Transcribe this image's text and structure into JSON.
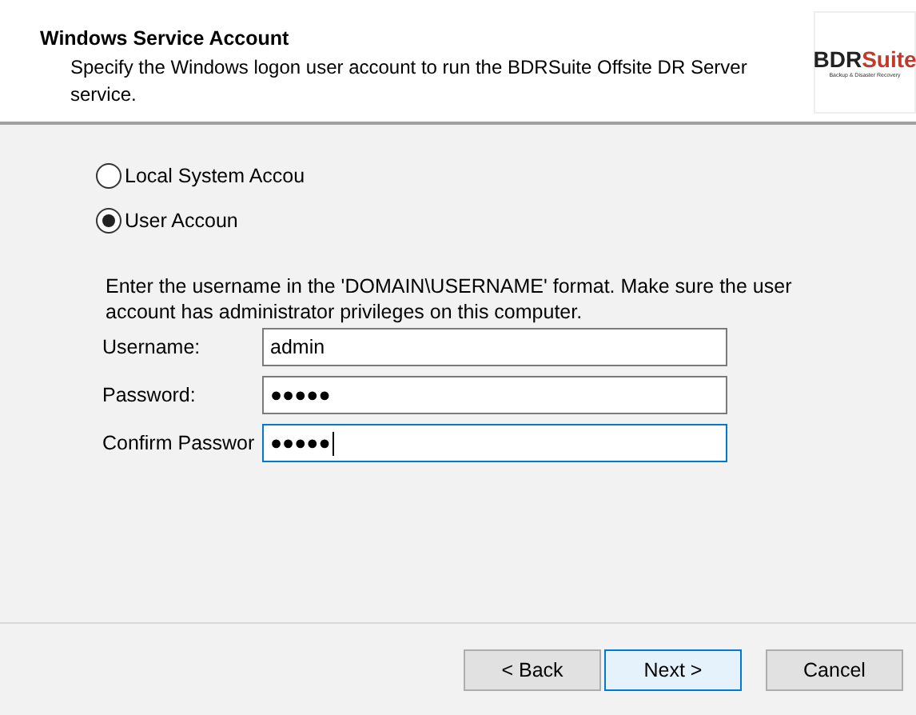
{
  "header": {
    "title": "Windows Service Account",
    "subtitle": "Specify the Windows logon user account to run the BDRSuite Offsite DR Server service.",
    "logo": {
      "strong": "BDR",
      "accent": "Suite",
      "tagline": "Backup & Disaster Recovery"
    }
  },
  "account_options": [
    {
      "label": "Local System Accou",
      "selected": false
    },
    {
      "label": "User Accoun",
      "selected": true
    }
  ],
  "note": "Enter the username in the 'DOMAIN\\USERNAME' format. Make sure the user account has administrator privileges on this computer.",
  "fields": [
    {
      "label": "Username:",
      "value": "admin",
      "focused": false
    },
    {
      "label": "Password:",
      "value": "●●●●●",
      "focused": false
    },
    {
      "label": "Confirm Passwor",
      "value": "●●●●●",
      "focused": true
    }
  ],
  "buttons": [
    {
      "label": "< Back",
      "default": false
    },
    {
      "label": "Next >",
      "default": true
    },
    {
      "label": "Cancel",
      "default": false
    }
  ]
}
